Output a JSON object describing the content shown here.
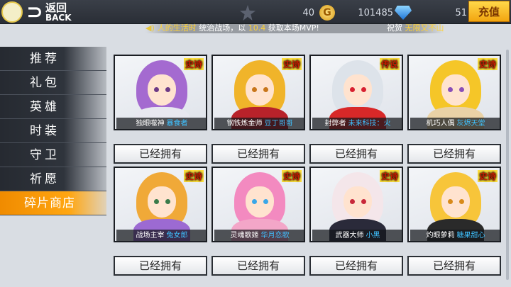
{
  "header": {
    "back_cn": "返回",
    "back_en": "BACK",
    "stars": "40",
    "gold": "101485",
    "gems": "51",
    "recharge_label": "充值"
  },
  "ticker": {
    "player": "人的生活时",
    "text1": " 统治战场，以 ",
    "score": "10.4",
    "text2": " 获取本场MVP!",
    "congrats": "祝贺 ",
    "target": "无限又不山"
  },
  "sidebar": {
    "items": [
      {
        "label": "推荐"
      },
      {
        "label": "礼包"
      },
      {
        "label": "英雄"
      },
      {
        "label": "时装"
      },
      {
        "label": "守卫"
      },
      {
        "label": "祈愿"
      },
      {
        "label": "碎片商店"
      }
    ],
    "active_index": 6
  },
  "cards": [
    {
      "rarity": "史诗",
      "hero": "独眼噬神",
      "author": "暴食者",
      "button": "已经拥有",
      "hair": "#a46ad0",
      "eye": "#6d3a86",
      "body": "#e8e8f0"
    },
    {
      "rarity": "史诗",
      "hero": "钢铁炼金师",
      "author": "豆丁哥哥",
      "button": "已经拥有",
      "hair": "#f0b42a",
      "eye": "#c8761a",
      "body": "#b8222a"
    },
    {
      "rarity": "传说",
      "hero": "封弊者",
      "author": "未来科技：火",
      "button": "已经拥有",
      "hair": "#dde3ea",
      "eye": "#d82030",
      "body": "#d82828"
    },
    {
      "rarity": "史诗",
      "hero": "机巧人偶",
      "author": "灰烬天堂",
      "button": "已经拥有",
      "hair": "#f5c628",
      "eye": "#8a4fb8",
      "body": "#ead2a6"
    },
    {
      "rarity": "史诗",
      "hero": "战场主宰",
      "author": "兔女郎",
      "button": "已经拥有",
      "hair": "#f0a938",
      "eye": "#3a7a4a",
      "body": "#9c6ad2"
    },
    {
      "rarity": "史诗",
      "hero": "灵魂歌姬",
      "author": "华月恋歌",
      "button": "已经拥有",
      "hair": "#f38ac0",
      "eye": "#3aa7e8",
      "body": "#f3a6c8"
    },
    {
      "rarity": "史诗",
      "hero": "武器大师",
      "author": "小黑",
      "button": "已经拥有",
      "hair": "#f4e6ea",
      "eye": "#c8283a",
      "body": "#2a2a3a"
    },
    {
      "rarity": "史诗",
      "hero": "灼眼萝莉",
      "author": "糖果甜心",
      "button": "已经拥有",
      "hair": "#f7c53a",
      "eye": "#d88a1a",
      "body": "#2a2a2a"
    }
  ]
}
